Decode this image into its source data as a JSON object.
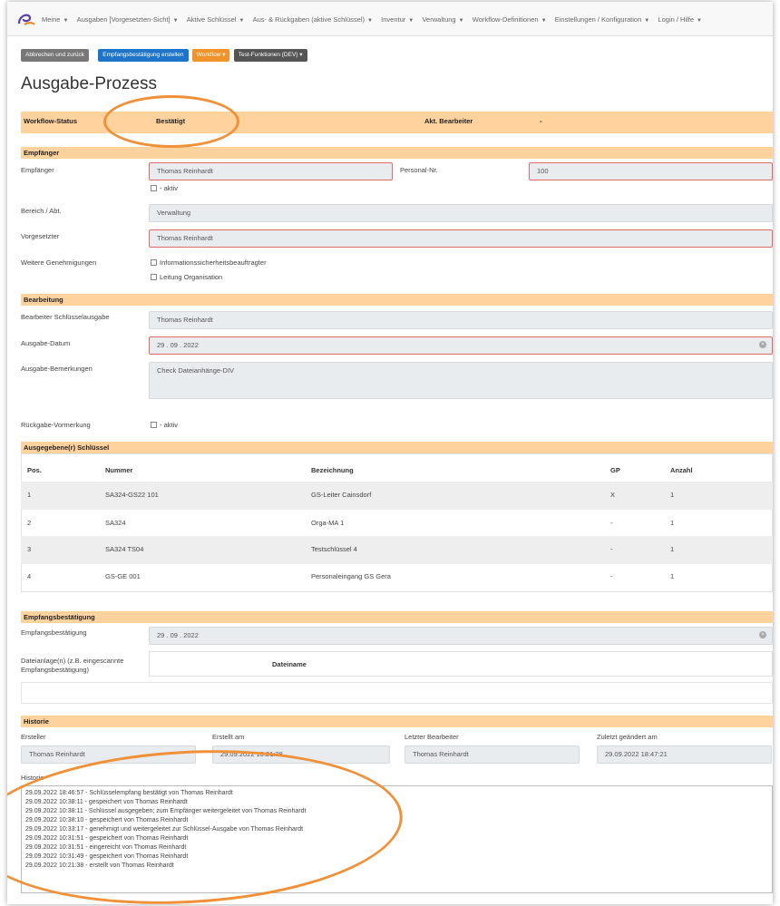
{
  "nav": {
    "items": [
      "Meine",
      "Ausgaben [Vorgesetzten-Sicht]",
      "Aktive Schlüssel",
      "Aus- & Rückgaben (aktive Schlüssel)",
      "Inventur",
      "Verwaltung",
      "Workflow-Definitionen",
      "Einstellungen / Konfiguration",
      "Login / Hilfe"
    ]
  },
  "toolbar": {
    "cancel": "Abbrechen und zurück",
    "create": "Empfangsbestätigung erstellen",
    "workflow": "Workflow",
    "test": "Test-Funktionen (DEV)"
  },
  "page_title": "Ausgabe-Prozess",
  "status": {
    "label": "Workflow-Status",
    "value": "Bestätigt",
    "editor_label": "Akt. Bearbeiter",
    "editor_value": "-"
  },
  "empfaenger": {
    "section": "Empfänger",
    "recipient_label": "Empfänger",
    "recipient_value": "Thomas Reinhardt",
    "active_label": "- aktiv",
    "personal_label": "Personal-Nr.",
    "personal_value": "100",
    "dept_label": "Bereich / Abt.",
    "dept_value": "Verwaltung",
    "supervisor_label": "Vorgesetzter",
    "supervisor_value": "Thomas Reinhardt",
    "approvals_label": "Weitere Genehmigungen",
    "approval_1": "Informationssicherheitsbeauftragter",
    "approval_2": "Leitung Organisation"
  },
  "bearbeitung": {
    "section": "Bearbeitung",
    "editor_label": "Bearbeiter Schlüsselausgabe",
    "editor_value": "Thomas Reinhardt",
    "date_label": "Ausgabe-Datum",
    "date_value": "29 . 09 . 2022",
    "remarks_label": "Ausgabe-Bemerkungen",
    "remarks_value": "Check Dateianhänge-DIV",
    "return_label": "Rückgabe-Vormerkung",
    "return_value": "- aktiv"
  },
  "keys": {
    "section": "Ausgegebene(r) Schlüssel",
    "headers": [
      "Pos.",
      "Nummer",
      "Bezeichnung",
      "GP",
      "Anzahl"
    ],
    "rows": [
      [
        "1",
        "SA324-GS22 101",
        "GS-Leiter Cainsdorf",
        "X",
        "1"
      ],
      [
        "2",
        "SA324",
        "Orga-MA 1",
        "-",
        "1"
      ],
      [
        "3",
        "SA324 TS04",
        "Testschlüssel 4",
        "-",
        "1"
      ],
      [
        "4",
        "GS-GE 001",
        "Personaleingang GS Gera",
        "-",
        "1"
      ]
    ]
  },
  "receipt": {
    "section": "Empfangsbestätigung",
    "label": "Empfangsbestätigung",
    "date_value": "29 . 09 . 2022",
    "attach_label": "Dateianlage(n) (z.B. eingescannte Empfangsbestätigung)",
    "filename_header": "Dateiname"
  },
  "history": {
    "section": "Historie",
    "creator_label": "Ersteller",
    "creator_value": "Thomas Reinhardt",
    "created_label": "Erstellt am",
    "created_value": "29.09.2022 10:21:38",
    "last_editor_label": "Letzter Bearbeiter",
    "last_editor_value": "Thomas Reinhardt",
    "modified_label": "Zuletzt geändert am",
    "modified_value": "29.09.2022 18:47:21",
    "list_label": "Historie",
    "entries": [
      "29.09.2022 18:46:57 - Schlüsselempfang bestätigt von Thomas Reinhardt",
      "29.09.2022 10:38:11 - gespeichert von Thomas Reinhardt",
      "29.09.2022 10:38:11 - Schlüssel ausgegeben; zum Empfänger weitergeleitet von Thomas Reinhardt",
      "29.09.2022 10:38:10 - gespeichert von Thomas Reinhardt",
      "29.09.2022 10:33:17 - genehmigt und weitergeleitet zur Schlüssel-Ausgabe von Thomas Reinhardt",
      "29.09.2022 10:31:51 - gespeichert von Thomas Reinhardt",
      "29.09.2022 10:31:51 - eingereicht von Thomas Reinhardt",
      "29.09.2022 10:31:49 - gespeichert von Thomas Reinhardt",
      "29.09.2022 10:21:38 - erstellt von Thomas Reinhardt"
    ]
  },
  "colors": {
    "section_bg": "#ffd29e",
    "highlight": "#f0913a",
    "primary": "#1e74c8",
    "required_border": "#e06a6a"
  }
}
